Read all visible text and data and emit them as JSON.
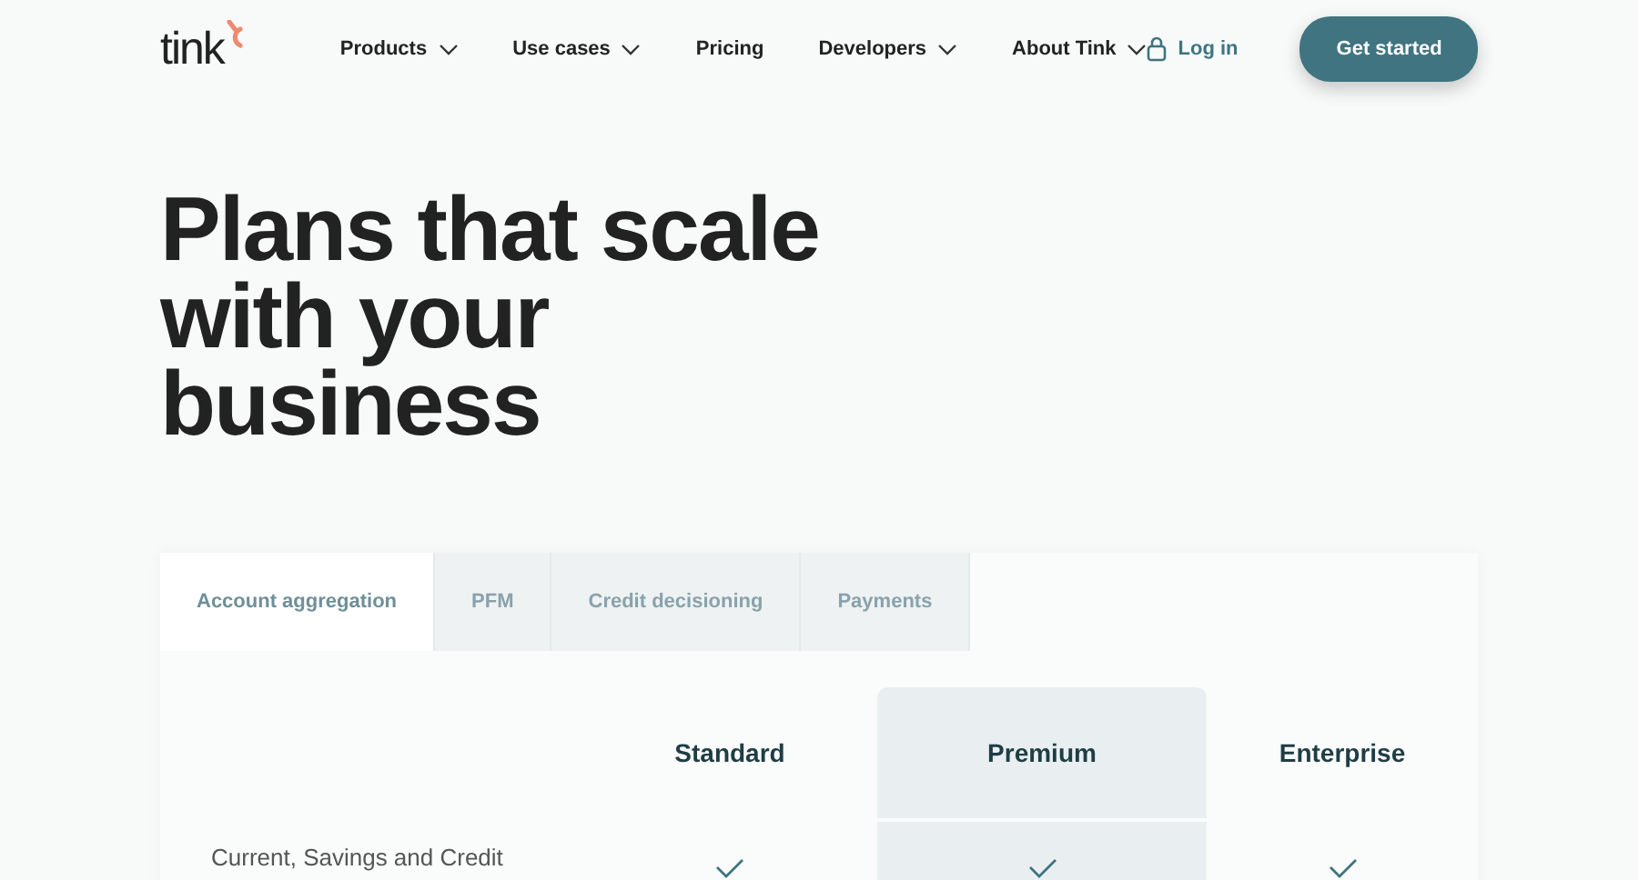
{
  "header": {
    "logo": "tink",
    "nav": [
      {
        "label": "Products",
        "has_menu": true
      },
      {
        "label": "Use cases",
        "has_menu": true
      },
      {
        "label": "Pricing",
        "has_menu": false
      },
      {
        "label": "Developers",
        "has_menu": true
      },
      {
        "label": "About Tink",
        "has_menu": true
      }
    ],
    "login": "Log in",
    "cta": "Get started"
  },
  "hero": {
    "title": "Plans that scale with your business"
  },
  "pricing": {
    "tabs": [
      {
        "label": "Account aggregation",
        "selected": true
      },
      {
        "label": "PFM",
        "selected": false
      },
      {
        "label": "Credit decisioning",
        "selected": false
      },
      {
        "label": "Payments",
        "selected": false
      }
    ],
    "plans": [
      {
        "name": "Standard",
        "highlighted": false
      },
      {
        "name": "Premium",
        "highlighted": true
      },
      {
        "name": "Enterprise",
        "highlighted": false
      }
    ],
    "rows": [
      {
        "feature": "Current, Savings and Credit",
        "included": [
          true,
          true,
          true
        ]
      }
    ]
  }
}
